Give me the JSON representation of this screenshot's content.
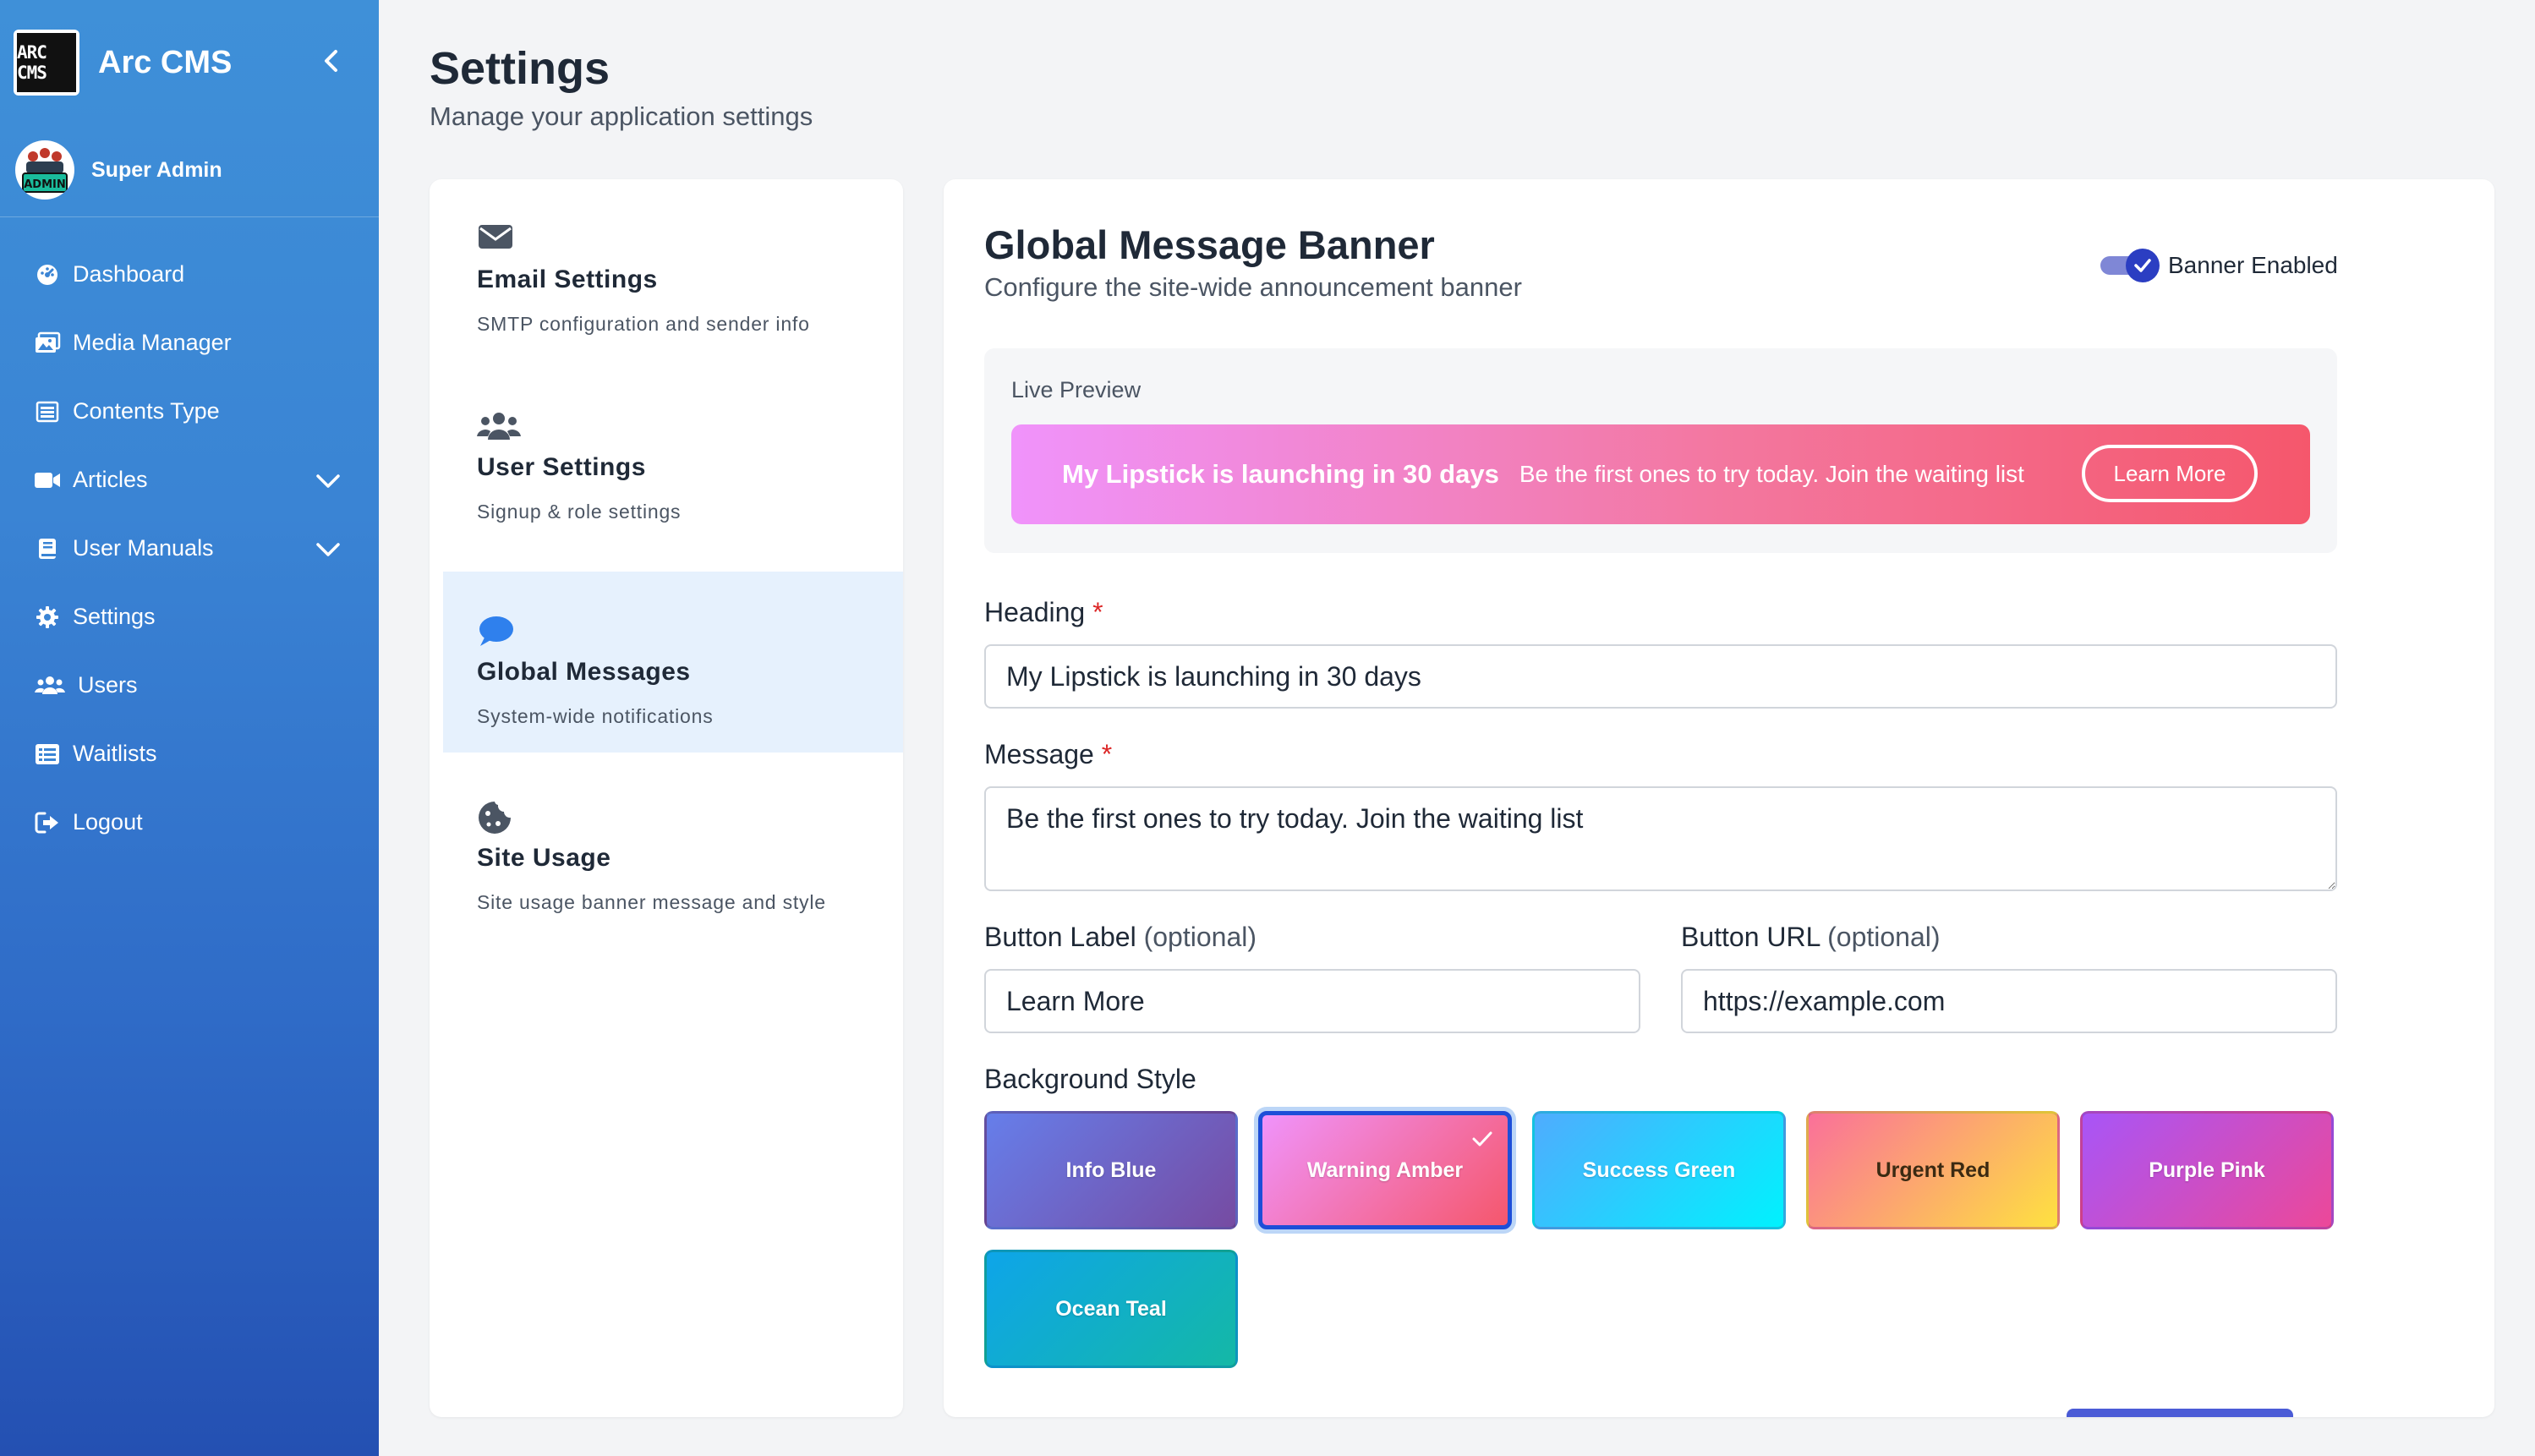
{
  "app": {
    "name": "Arc CMS",
    "logo_text": "ARC CMS"
  },
  "user": {
    "name": "Super Admin",
    "avatar_text": "ADMIN"
  },
  "nav": [
    {
      "label": "Dashboard",
      "icon": "dashboard-icon"
    },
    {
      "label": "Media Manager",
      "icon": "image-icon"
    },
    {
      "label": "Contents Type",
      "icon": "list-icon"
    },
    {
      "label": "Articles",
      "icon": "video-icon",
      "expandable": true
    },
    {
      "label": "User Manuals",
      "icon": "book-icon",
      "expandable": true
    },
    {
      "label": "Settings",
      "icon": "gear-icon"
    },
    {
      "label": "Users",
      "icon": "users-icon"
    },
    {
      "label": "Waitlists",
      "icon": "table-list-icon"
    },
    {
      "label": "Logout",
      "icon": "logout-icon"
    }
  ],
  "page": {
    "title": "Settings",
    "subtitle": "Manage your application settings"
  },
  "settings_menu": [
    {
      "title": "Email Settings",
      "desc": "SMTP configuration and sender info",
      "icon": "envelope-icon",
      "active": false
    },
    {
      "title": "User Settings",
      "desc": "Signup & role settings",
      "icon": "users-icon",
      "active": false
    },
    {
      "title": "Global Messages",
      "desc": "System-wide notifications",
      "icon": "chat-bubble-icon",
      "active": true
    },
    {
      "title": "Site Usage",
      "desc": "Site usage banner message and style",
      "icon": "cookie-icon",
      "active": false
    }
  ],
  "panel": {
    "title": "Global Message Banner",
    "subtitle": "Configure the site-wide announcement banner",
    "toggle_label": "Banner Enabled",
    "toggle_on": true,
    "preview_label": "Live Preview",
    "preview": {
      "heading": "My Lipstick is launching in 30 days",
      "message": "Be the first ones to try today. Join the waiting list",
      "button": "Learn More"
    },
    "heading_label": "Heading",
    "heading_value": "My Lipstick is launching in 30 days",
    "message_label": "Message",
    "message_value": "Be the first ones to try today. Join the waiting list",
    "button_label_label": "Button Label",
    "button_label_value": "Learn More",
    "button_url_label": "Button URL",
    "button_url_value": "https://example.com",
    "optional_text": "(optional)",
    "required_mark": "*",
    "background_label": "Background Style",
    "styles": [
      {
        "name": "Info Blue",
        "from": "#667eea",
        "to": "#764ba2",
        "selected": false
      },
      {
        "name": "Warning Amber",
        "from": "#f093fb",
        "to": "#f5576c",
        "selected": true
      },
      {
        "name": "Success Green",
        "from": "#4facfe",
        "to": "#00f2fe",
        "selected": false
      },
      {
        "name": "Urgent Red",
        "from": "#fa709a",
        "to": "#fee140",
        "selected": false
      },
      {
        "name": "Purple Pink",
        "from": "#a855f7",
        "to": "#ec4899",
        "selected": false
      },
      {
        "name": "Ocean Teal",
        "from": "#0ea5e9",
        "to": "#14b8a6",
        "selected": false
      }
    ]
  },
  "colors": {
    "accent": "#2b3ec2",
    "active_menu_bg": "#e6f1fd",
    "chat_icon": "#2f80ed"
  }
}
